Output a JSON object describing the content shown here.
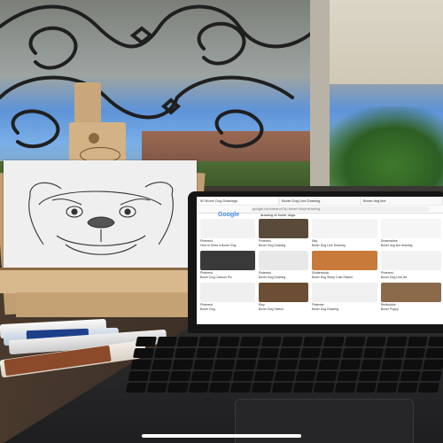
{
  "browser": {
    "tabs": [
      {
        "label": "50 Boxer Dog Drawings"
      },
      {
        "label": "Boxer Dog Line Drawing"
      },
      {
        "label": "Boxer dog line"
      }
    ],
    "address": "google.com/search?q=boxer+dog+drawing",
    "brand": "Google",
    "results_heading": "drawing of boxer dogs"
  },
  "results": [
    {
      "source": "Pinterest",
      "caption": "How to Draw a Boxer Dog"
    },
    {
      "source": "Pinterest",
      "caption": "Boxer Dog Drawing"
    },
    {
      "source": "Etsy",
      "caption": "Boxer Dog Line Drawing"
    },
    {
      "source": "Dreamstime",
      "caption": "Boxer dog line drawing"
    },
    {
      "source": "Pinterest",
      "caption": "Boxer Dog Cartoon Pic"
    },
    {
      "source": "Pinterest",
      "caption": "Boxer Dog Drawing"
    },
    {
      "source": "Shutterstock",
      "caption": "Boxer Dog Sleep Cute Sticker"
    },
    {
      "source": "Pinterest",
      "caption": "Boxer Dog Line Art"
    },
    {
      "source": "Pinterest",
      "caption": "Boxer Dog"
    },
    {
      "source": "Etsy",
      "caption": "Boxer Dog Sketch"
    },
    {
      "source": "Pinterest",
      "caption": "Boxer Dog Drawing"
    },
    {
      "source": "Redbubble",
      "caption": "Boxer Puppy"
    }
  ],
  "colors": {
    "table": "#3a2e25",
    "easel": "#c9a77a",
    "laptop": "#151515"
  }
}
